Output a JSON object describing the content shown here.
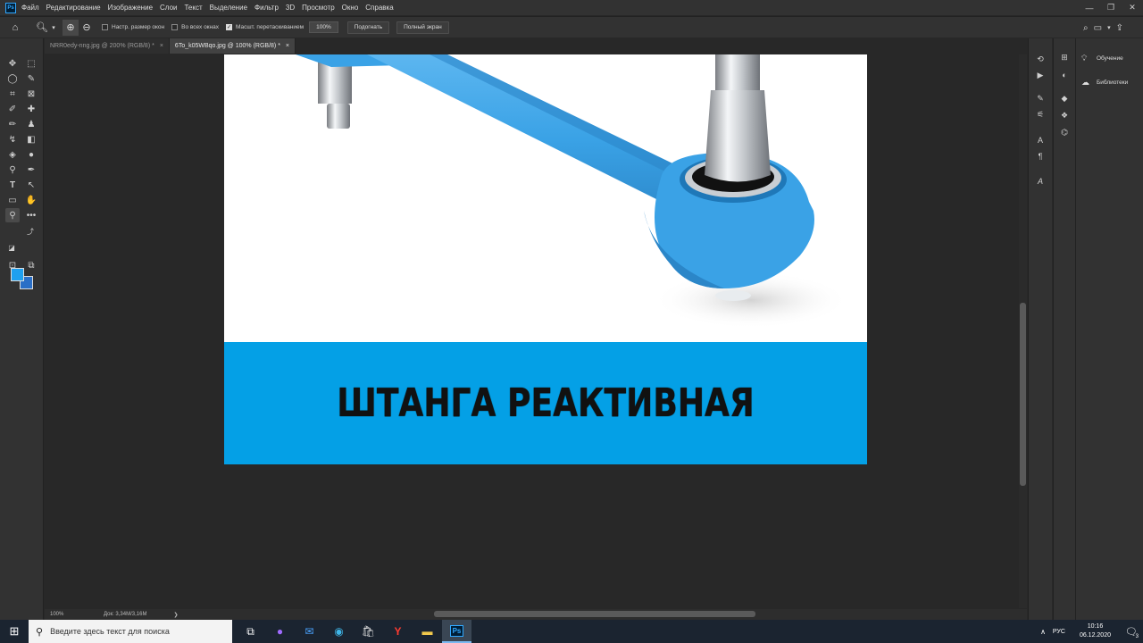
{
  "app": {
    "logo": "Ps",
    "menu": [
      "Файл",
      "Редактирование",
      "Изображение",
      "Слои",
      "Текст",
      "Выделение",
      "Фильтр",
      "3D",
      "Просмотр",
      "Окно",
      "Справка"
    ],
    "window_controls": [
      "—",
      "❐",
      "✕"
    ]
  },
  "options_bar": {
    "resize_windows_label": "Настр. размер окон",
    "all_windows_label": "Во всех окнах",
    "scrubby_zoom_label": "Масшт. перетаскиванием",
    "zoom_value": "100%",
    "fit_button": "Подогнать",
    "full_screen_button": "Полный экран"
  },
  "tabs": [
    {
      "label": "NRR0edy-nng.jpg @ 200% (RGB/8) *",
      "close": "×"
    },
    {
      "label": "6To_k05WBqo.jpg @ 100% (RGB/8) *",
      "close": "×"
    }
  ],
  "document": {
    "banner_text": "ШТАНГА РЕАКТИВНАЯ",
    "banner_color": "#04a0e6",
    "bar_color": "#3aa2e6"
  },
  "status": {
    "zoom": "100%",
    "doc_size": "Док: 3,34M/3,16M",
    "arrow": "❯"
  },
  "right_panel": {
    "learn_label": "Обучение",
    "libraries_label": "Библиотеки"
  },
  "colors": {
    "foreground": "#1ea0f0",
    "background": "#2a6fc7"
  },
  "taskbar": {
    "search_placeholder": "Введите здесь текст для поиска",
    "language": "РУС",
    "time": "10:16",
    "date": "06.12.2020",
    "notification_count": "3"
  }
}
